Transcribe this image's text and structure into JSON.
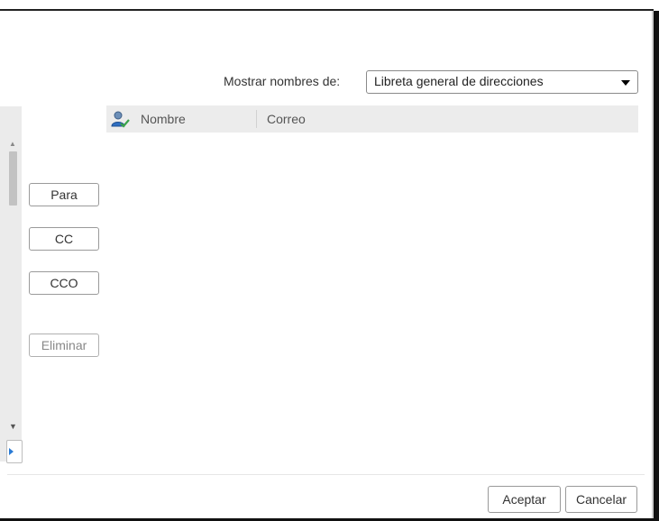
{
  "filter": {
    "label": "Mostrar nombres de:",
    "selected": "Libreta general de direcciones"
  },
  "recipient_buttons": {
    "to": "Para",
    "cc": "CC",
    "bcc": "CCO",
    "remove": "Eliminar"
  },
  "table": {
    "columns": [
      "Nombre",
      "Correo"
    ],
    "rows": []
  },
  "footer": {
    "ok": "Aceptar",
    "cancel": "Cancelar"
  },
  "icons": {
    "column_icon": "contact-person-check-icon",
    "dropdown": "caret-down-icon",
    "expand": "triangle-right-icon"
  },
  "colors": {
    "accent": "#2a7bd5",
    "header_bg": "#ececec"
  }
}
